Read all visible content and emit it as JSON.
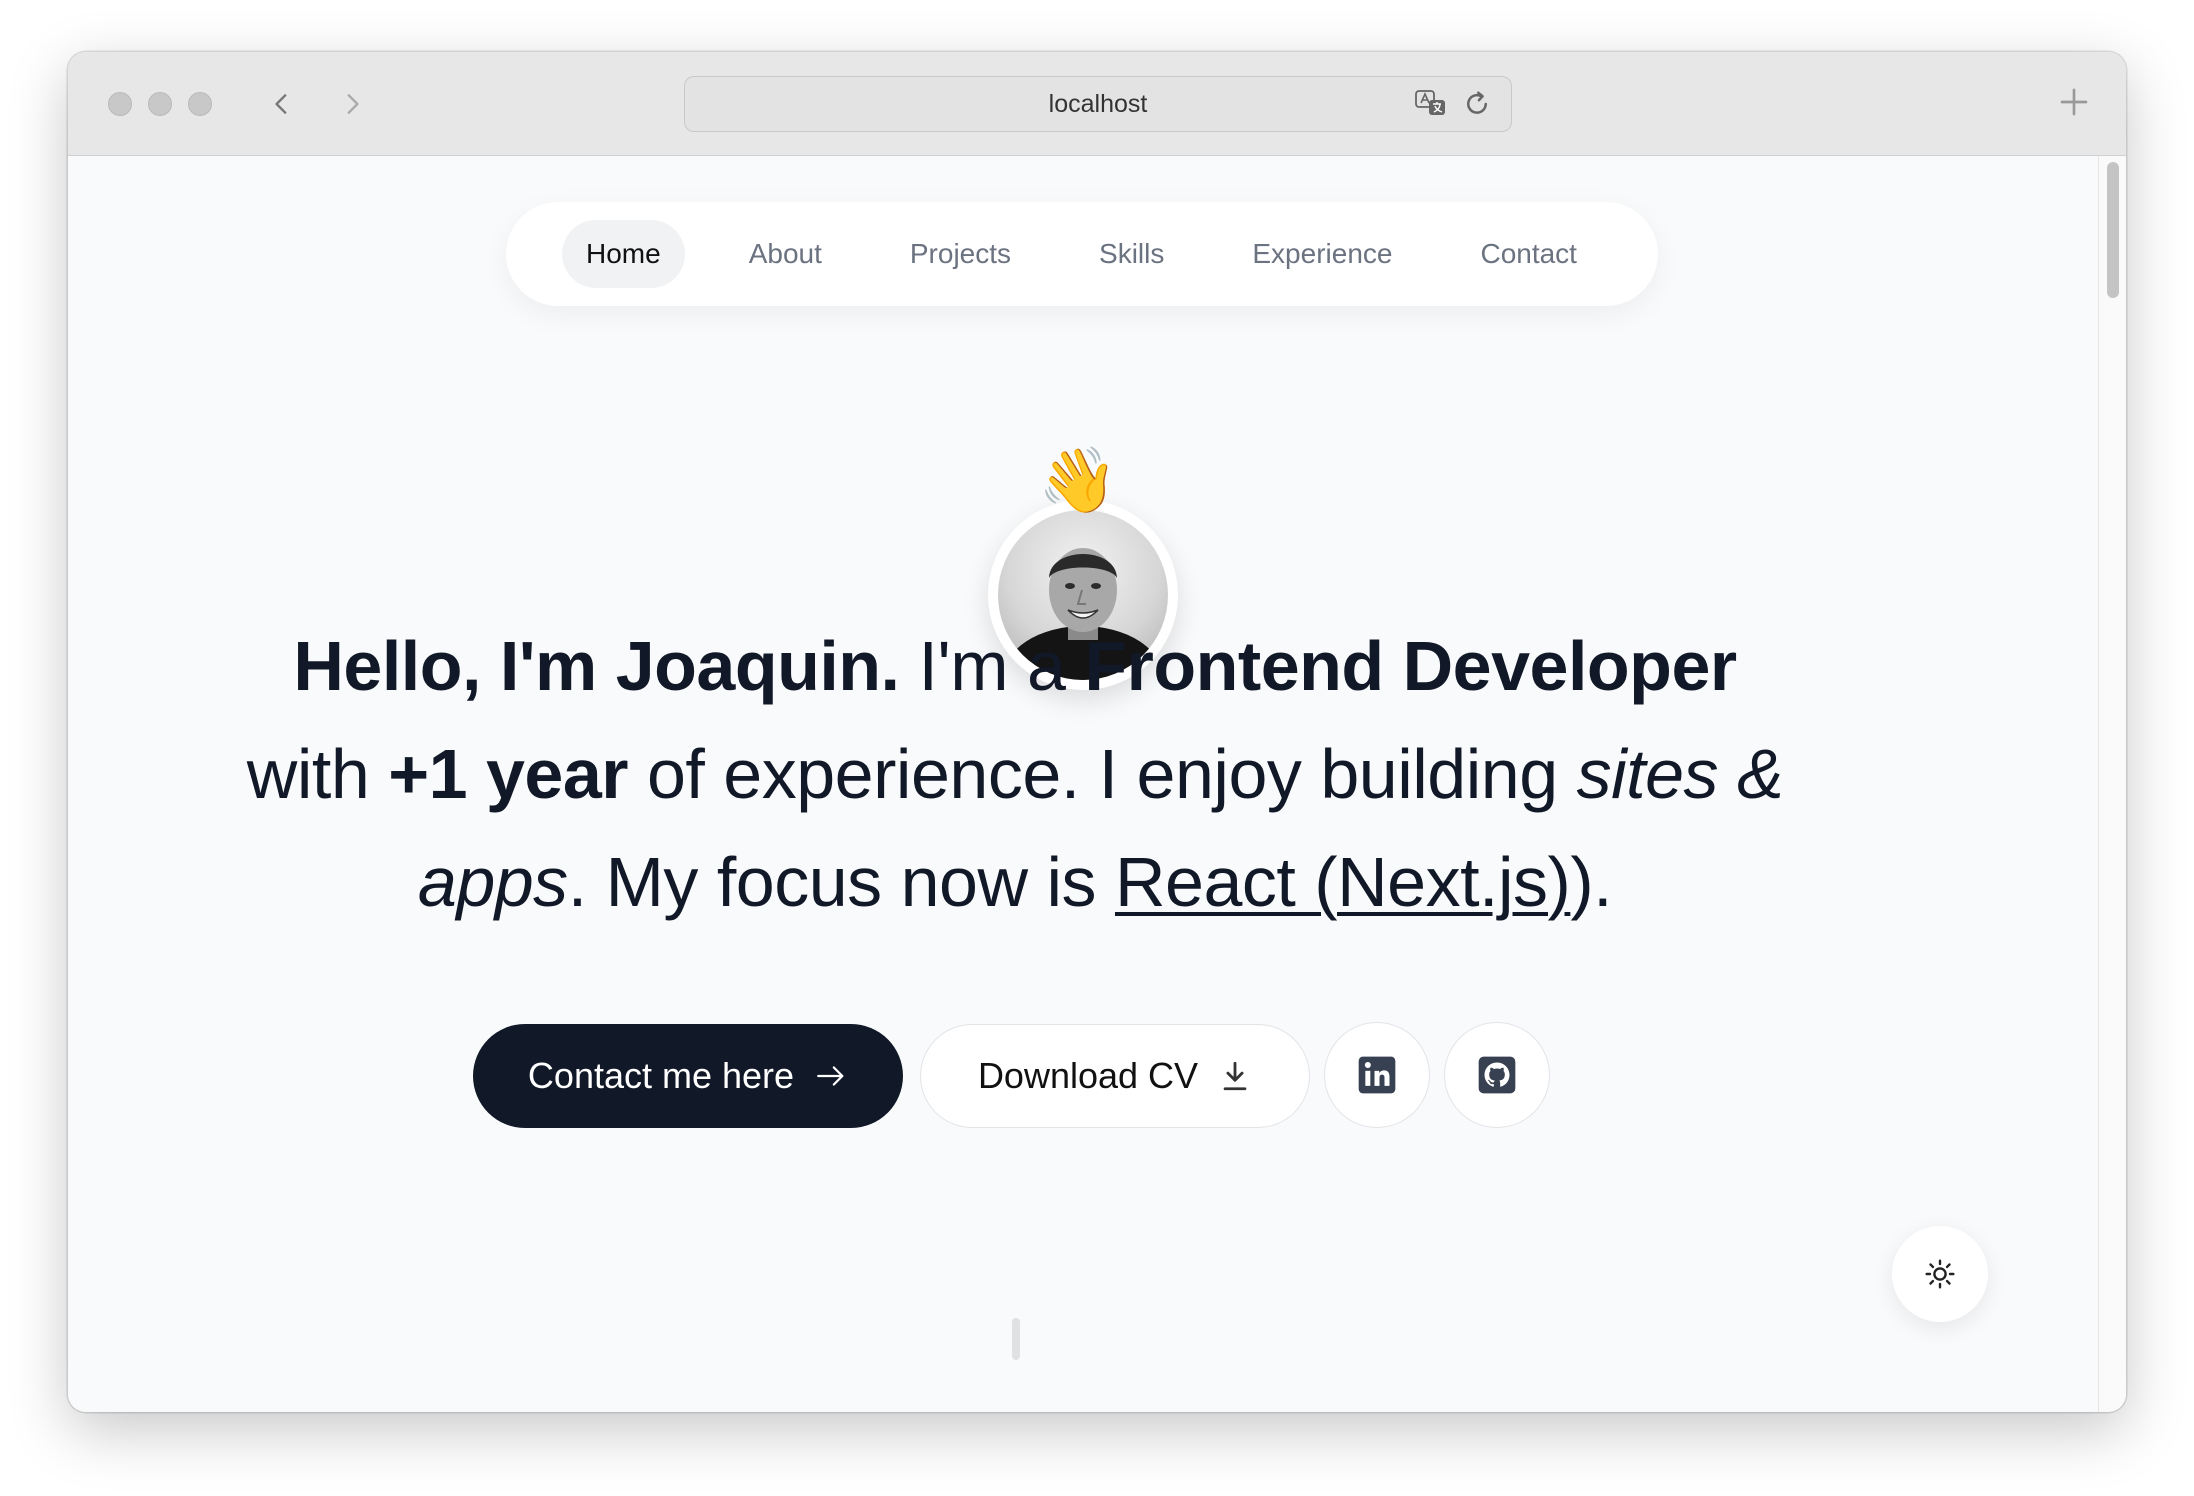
{
  "browser": {
    "url": "localhost"
  },
  "nav": {
    "items": [
      "Home",
      "About",
      "Projects",
      "Skills",
      "Experience",
      "Contact"
    ],
    "active": "Home"
  },
  "hero": {
    "greeting": "Hello, I'm Joaquin.",
    "t1": " I'm a ",
    "role": "Frontend Developer",
    "t2": " with ",
    "years": "+1 year",
    "t3": " of experience. I enjoy building ",
    "italic": "sites & apps",
    "t4": ". My focus now is ",
    "tech": "React (Next.js)",
    "t5": ").",
    "wave_emoji": "👋"
  },
  "buttons": {
    "contact": "Contact me here",
    "download": "Download CV"
  },
  "icons": {
    "linkedin": "linkedin-icon",
    "github": "github-icon",
    "theme": "sun-icon"
  }
}
